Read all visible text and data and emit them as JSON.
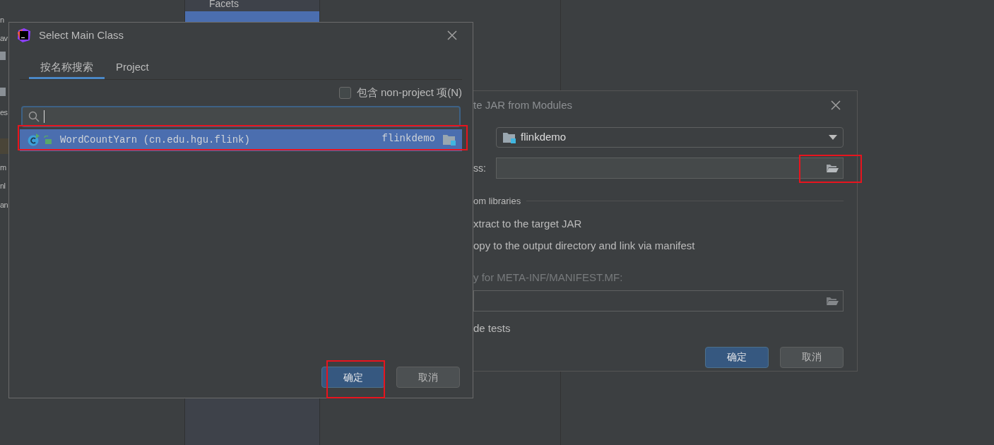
{
  "background": {
    "left_fragments": [
      "n",
      "av",
      "es",
      "m",
      "nl",
      "an"
    ],
    "sidebar": {
      "items": [
        {
          "label": "Facets",
          "selected": false
        },
        {
          "selected": true
        }
      ]
    }
  },
  "back_dialog": {
    "title": "te JAR from Modules",
    "module_value": "flinkdemo",
    "main_class_label": "ss:",
    "libraries_group": "om libraries",
    "options": [
      {
        "label": "xtract to the target JAR"
      },
      {
        "label": "opy to the output directory and link via manifest"
      }
    ],
    "manifest": {
      "label": "y for META-INF/MANIFEST.MF:",
      "disabled": true
    },
    "tests_label": "de tests",
    "buttons": [
      {
        "label": "确定",
        "kind": "primary"
      },
      {
        "label": "取消",
        "kind": "secondary"
      }
    ]
  },
  "dialog": {
    "title": "Select Main Class",
    "tabs": [
      {
        "label": "按名称搜索",
        "selected": true
      },
      {
        "label": "Project",
        "selected": false
      }
    ],
    "include_checkbox": {
      "label": "包含 non-project 项(N)",
      "checked": false
    },
    "results": [
      {
        "name": "WordCountYarn",
        "package": "(cn.edu.hgu.flink)",
        "module": "flinkdemo",
        "selected": true
      }
    ],
    "buttons": [
      {
        "label": "确定",
        "kind": "primary"
      },
      {
        "label": "取消",
        "kind": "secondary"
      }
    ]
  }
}
